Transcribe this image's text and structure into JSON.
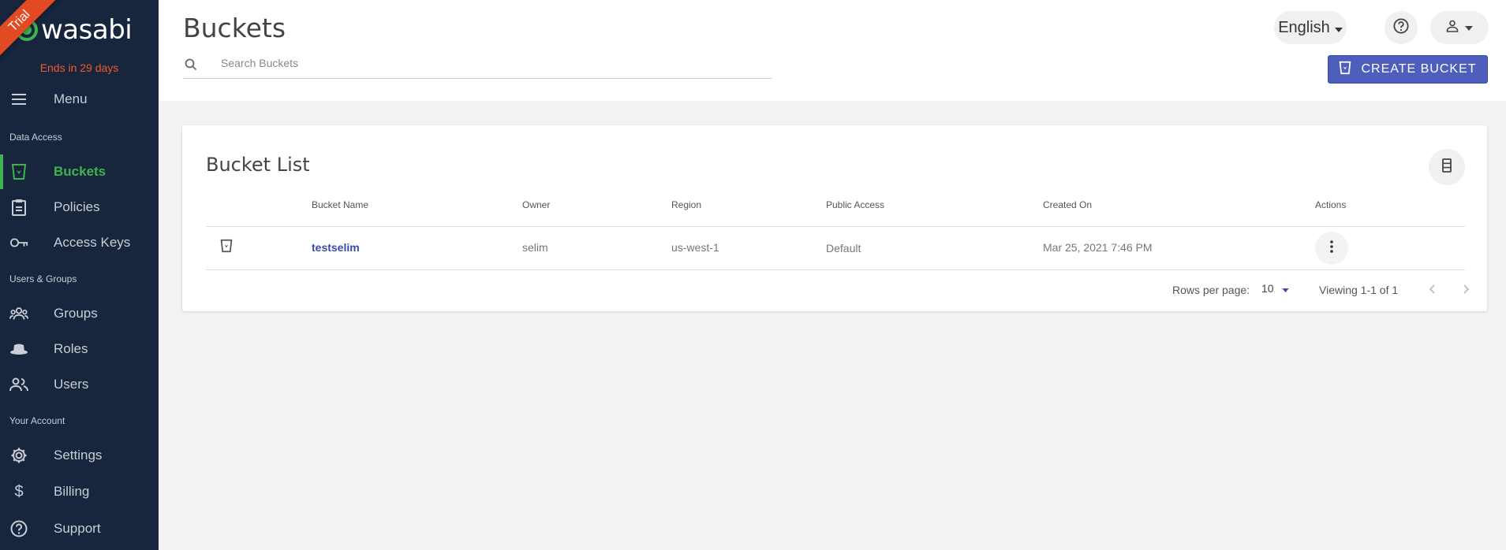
{
  "colors": {
    "sidebar_bg": "#17263c",
    "accent_green": "#3fb34f",
    "trial_orange": "#e24a24",
    "primary_button": "#4e5ebd",
    "link_blue": "#3b4ba5"
  },
  "sidebar": {
    "trial_ribbon": "Trial",
    "logo_text": "wasabi",
    "trial_notice": "Ends in 29 days",
    "menu": {
      "label": "Menu",
      "icon": "hamburger-icon"
    },
    "sections": {
      "data_access": "Data Access",
      "users_groups": "Users & Groups",
      "your_account": "Your Account"
    },
    "items": [
      {
        "label": "Buckets",
        "icon": "bucket-icon",
        "active": true
      },
      {
        "label": "Policies",
        "icon": "clipboard-icon",
        "active": false
      },
      {
        "label": "Access Keys",
        "icon": "key-icon",
        "active": false
      },
      {
        "label": "Groups",
        "icon": "groups-icon",
        "active": false
      },
      {
        "label": "Roles",
        "icon": "hat-icon",
        "active": false
      },
      {
        "label": "Users",
        "icon": "users-icon",
        "active": false
      },
      {
        "label": "Settings",
        "icon": "gear-icon",
        "active": false
      },
      {
        "label": "Billing",
        "icon": "dollar-icon",
        "active": false
      },
      {
        "label": "Support",
        "icon": "help-icon",
        "active": false
      }
    ]
  },
  "header": {
    "title": "Buckets",
    "search_placeholder": "Search Buckets",
    "language": "English",
    "create_button": "CREATE BUCKET"
  },
  "bucket_list": {
    "title": "Bucket List",
    "columns": [
      "Bucket Name",
      "Owner",
      "Region",
      "Public Access",
      "Created On",
      "Actions"
    ],
    "rows": [
      {
        "name": "testselim",
        "owner": "selim",
        "region": "us-west-1",
        "public_access": "Default",
        "created_on": "Mar 25, 2021 7:46 PM"
      }
    ],
    "footer": {
      "rows_per_page_label": "Rows per page:",
      "rows_per_page": "10",
      "viewing": "Viewing 1-1 of 1"
    }
  }
}
